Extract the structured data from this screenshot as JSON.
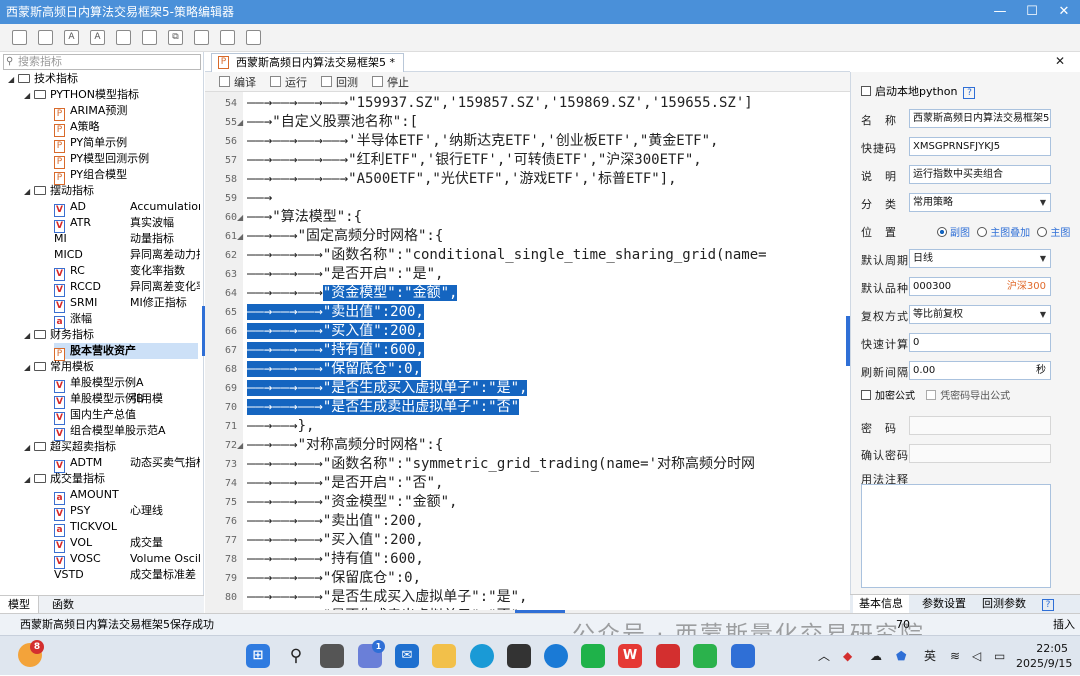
{
  "window": {
    "title": "西蒙斯高频日内算法交易框架5-策略编辑器",
    "btn_min": "—",
    "btn_max": "☐",
    "btn_close": "✕"
  },
  "toolbar": {
    "icons": [
      "save-icon",
      "save-all-icon",
      "font-decrease-icon",
      "font-increase-icon",
      "export-icon",
      "import-icon",
      "copy-icon",
      "list-icon",
      "settings-icon",
      "image-icon"
    ],
    "glyphs": {
      "font_dec": "A",
      "font_inc": "A",
      "copy": "⧉"
    }
  },
  "left": {
    "search_placeholder": "搜索指标",
    "search_icon": "⚲",
    "tree": [
      {
        "label": "技术指标",
        "kind": "folder",
        "indent": 0,
        "arrow": "◢"
      },
      {
        "label": "PYTHON模型指标",
        "kind": "folder",
        "indent": 1,
        "arrow": "◢"
      },
      {
        "label": "ARIMA预测",
        "kind": "py",
        "indent": 2
      },
      {
        "label": "A策略",
        "kind": "py",
        "indent": 2
      },
      {
        "label": "PY简单示例",
        "kind": "py",
        "indent": 2
      },
      {
        "label": "PY模型回测示例",
        "kind": "py",
        "indent": 2
      },
      {
        "label": "PY组合模型",
        "kind": "py",
        "indent": 2
      },
      {
        "label": "摆动指标",
        "kind": "folder",
        "indent": 1,
        "arrow": "◢"
      },
      {
        "label": "AD",
        "desc": "Accumulation or",
        "kind": "v",
        "indent": 2
      },
      {
        "label": "ATR",
        "desc": "真实波幅",
        "kind": "v",
        "indent": 2
      },
      {
        "label": "MI",
        "desc": "动量指标",
        "kind": "none",
        "indent": 2
      },
      {
        "label": "MICD",
        "desc": "异同离差动力指数",
        "kind": "none",
        "indent": 2
      },
      {
        "label": "RC",
        "desc": "变化率指数",
        "kind": "v",
        "indent": 2
      },
      {
        "label": "RCCD",
        "desc": "异同离差变化率",
        "kind": "v",
        "indent": 2
      },
      {
        "label": "SRMI",
        "desc": "MI修正指标",
        "kind": "v",
        "indent": 2
      },
      {
        "label": "涨幅",
        "kind": "av",
        "indent": 2
      },
      {
        "label": "财务指标",
        "kind": "folder",
        "indent": 1,
        "arrow": "◢"
      },
      {
        "label": "股本营收资产",
        "kind": "py",
        "indent": 2,
        "selected": true
      },
      {
        "label": "常用模板",
        "kind": "folder",
        "indent": 1,
        "arrow": "◢"
      },
      {
        "label": "单股模型示例A",
        "kind": "v",
        "indent": 2
      },
      {
        "label": "单股模型示例B",
        "desc": "引用模",
        "kind": "v",
        "indent": 2
      },
      {
        "label": "国内生产总值",
        "kind": "v",
        "indent": 2
      },
      {
        "label": "组合模型单股示范A",
        "kind": "v",
        "indent": 2
      },
      {
        "label": "超买超卖指标",
        "kind": "folder",
        "indent": 1,
        "arrow": "◢"
      },
      {
        "label": "ADTM",
        "desc": "动态买卖气指标",
        "kind": "v",
        "indent": 2
      },
      {
        "label": "成交量指标",
        "kind": "folder",
        "indent": 1,
        "arrow": "◢"
      },
      {
        "label": "AMOUNT",
        "kind": "av",
        "indent": 2
      },
      {
        "label": "PSY",
        "desc": "心理线",
        "kind": "v",
        "indent": 2
      },
      {
        "label": "TICKVOL",
        "kind": "av",
        "indent": 2
      },
      {
        "label": "VOL",
        "desc": "成交量",
        "kind": "v",
        "indent": 2
      },
      {
        "label": "VOSC",
        "desc": "Volume Oscilla",
        "kind": "v",
        "indent": 2
      },
      {
        "label": "VSTD",
        "desc": "成交量标准差",
        "kind": "none",
        "indent": 2
      }
    ],
    "tabs": [
      "模型",
      "函数"
    ]
  },
  "editor": {
    "tab_label": "西蒙斯高频日内算法交易框架5 *",
    "tab_icon": "P",
    "close_glyph": "✕",
    "actions": [
      "编译",
      "运行",
      "回测",
      "停止"
    ],
    "lines": [
      {
        "n": "54",
        "text": "——→——→——→——→\"159937.SZ\",'159857.SZ','159869.SZ','159655.SZ']"
      },
      {
        "n": "55",
        "text": "——→\"自定义股票池名称\":[",
        "fold": "◢"
      },
      {
        "n": "56",
        "text": "——→——→——→——→'半导体ETF','纳斯达克ETF','创业板ETF',\"黄金ETF\","
      },
      {
        "n": "57",
        "text": "——→——→——→——→\"红利ETF\",'银行ETF','可转债ETF',\"沪深300ETF\","
      },
      {
        "n": "58",
        "text": "——→——→——→——→\"A500ETF\",\"光伏ETF\",'游戏ETF','标普ETF\"],"
      },
      {
        "n": "59",
        "text": "——→"
      },
      {
        "n": "60",
        "text": "——→\"算法模型\":{",
        "fold": "◢"
      },
      {
        "n": "61",
        "text": "——→——→\"固定高频分时网格\":{",
        "fold": "◢"
      },
      {
        "n": "62",
        "text": "——→——→——→\"函数名称\":\"conditional_single_time_sharing_grid(name="
      },
      {
        "n": "63",
        "text": "——→——→——→\"是否开启\":\"是\","
      },
      {
        "n": "64",
        "pre": "——→——→——→",
        "sel": "\"资金模型\":\"金额\","
      },
      {
        "n": "65",
        "pre": "",
        "sel": "——→——→——→\"卖出值\":200,"
      },
      {
        "n": "66",
        "pre": "",
        "sel": "——→——→——→\"买入值\":200,"
      },
      {
        "n": "67",
        "pre": "",
        "sel": "——→——→——→\"持有值\":600,"
      },
      {
        "n": "68",
        "pre": "",
        "sel": "——→——→——→\"保留底仓\":0,"
      },
      {
        "n": "69",
        "pre": "",
        "sel": "——→——→——→\"是否生成买入虚拟单子\":\"是\","
      },
      {
        "n": "70",
        "pre": "",
        "sel": "——→——→——→\"是否生成卖出虚拟单子\":\"否\""
      },
      {
        "n": "71",
        "text": "——→——→},"
      },
      {
        "n": "72",
        "text": "——→——→\"对称高频分时网格\":{",
        "fold": "◢"
      },
      {
        "n": "73",
        "text": "——→——→——→\"函数名称\":\"symmetric_grid_trading(name='对称高频分时网"
      },
      {
        "n": "74",
        "text": "——→——→——→\"是否开启\":\"否\","
      },
      {
        "n": "75",
        "text": "——→——→——→\"资金模型\":\"金额\","
      },
      {
        "n": "76",
        "text": "——→——→——→\"卖出值\":200,"
      },
      {
        "n": "77",
        "text": "——→——→——→\"买入值\":200,"
      },
      {
        "n": "78",
        "text": "——→——→——→\"持有值\":600,"
      },
      {
        "n": "79",
        "text": "——→——→——→\"保留底仓\":0,"
      },
      {
        "n": "80",
        "text": "——→——→——→\"是否生成买入虚拟单子\":\"是\","
      },
      {
        "n": "81",
        "text": "——→——→——→\"是否生成卖出虚拟单子\":\"否\""
      }
    ]
  },
  "right": {
    "enable_python": "启动本地python",
    "help_glyph": "?",
    "name_label": "名　称",
    "name_value": "西蒙斯高频日内算法交易框架5",
    "code_label": "快捷码",
    "code_value": "XMSGPRNSFJYKJ5",
    "desc_label": "说　明",
    "desc_value": "运行指数中买卖组合",
    "cat_label": "分　类",
    "cat_value": "常用策略",
    "pos_label": "位　置",
    "pos_options": [
      "副图",
      "主图叠加",
      "主图"
    ],
    "period_label": "默认周期",
    "period_value": "日线",
    "symbol_label": "默认品种",
    "symbol_value": "000300",
    "symbol_name": "沪深300",
    "adjust_label": "复权方式",
    "adjust_value": "等比前复权",
    "fast_label": "快速计算",
    "fast_value": "0",
    "refresh_label": "刷新间隔",
    "refresh_value": "0.00",
    "refresh_unit": "秒",
    "encrypt_label": "加密公式",
    "export_label": "凭密码导出公式",
    "pwd_label": "密　码",
    "pwd_confirm_label": "确认密码",
    "note_label": "用法注释",
    "tabs": [
      "基本信息",
      "参数设置",
      "回测参数"
    ]
  },
  "status": {
    "message": "西蒙斯高频日内算法交易框架5保存成功",
    "pos": "70",
    "insert": "插入"
  },
  "watermark": "公众号 · 西蒙斯量化交易研究院",
  "taskbar": {
    "badge_left": "8",
    "badge_store": "1",
    "ime": "英",
    "time": "22:05",
    "date": "2025/9/15",
    "tray_up": "︿",
    "icons": [
      "start-icon",
      "search-icon",
      "task-view-icon",
      "store-icon",
      "mail-icon",
      "file-explorer-icon",
      "edge-icon",
      "terminal-icon",
      "edge-dev-icon",
      "chat-icon",
      "wps-icon",
      "wps-pdf-icon",
      "wechat-icon",
      "app-icon"
    ]
  },
  "colors": {
    "accent": "#2f6fd6",
    "titlebar": "#4a90d9",
    "selection": "#1565c0",
    "red": "#d62828"
  }
}
